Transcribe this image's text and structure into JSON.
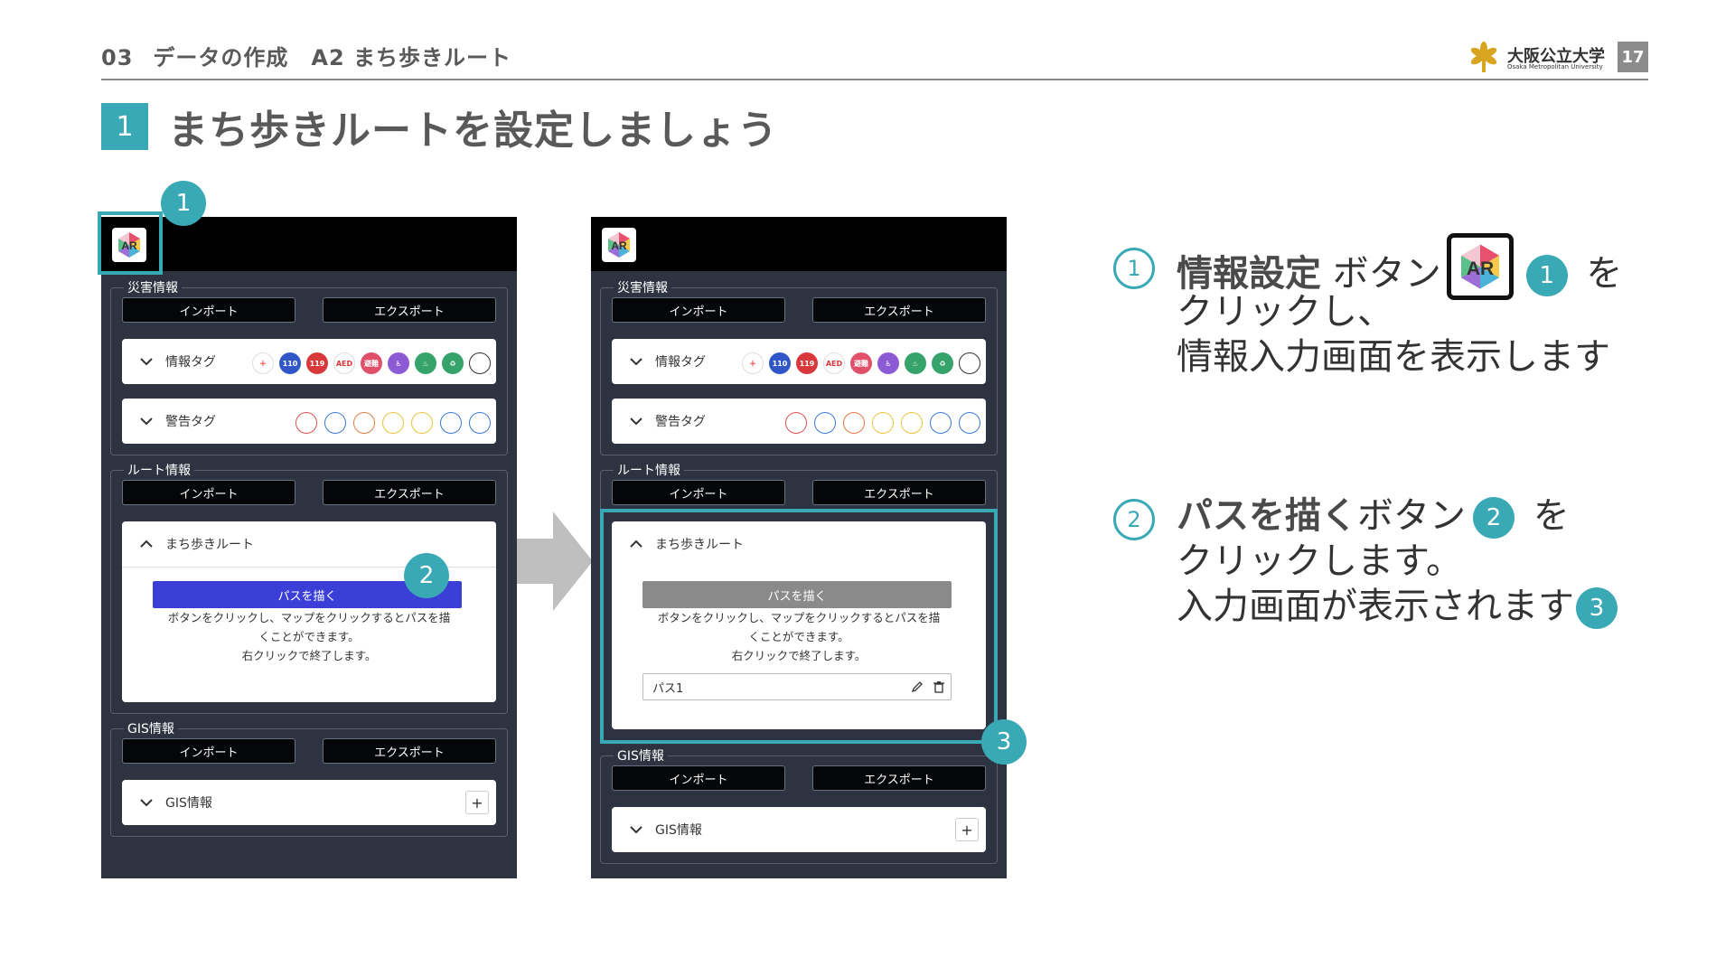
{
  "header": {
    "section_number": "03",
    "section_title": "データの作成　A2 まち歩きルート",
    "university_jp": "大阪公立大学",
    "university_en": "Osaka Metropolitan University",
    "page_number": "17"
  },
  "title": {
    "number": "1",
    "text": "まち歩きルートを設定しましょう"
  },
  "app": {
    "disaster_group": "災害情報",
    "route_group": "ルート情報",
    "gis_group": "GIS情報",
    "import_label": "インポート",
    "export_label": "エクスポート",
    "info_tag_label": "情報タグ",
    "info_tags": [
      "＋",
      "110",
      "119",
      "AED",
      "避難",
      "♿",
      "♨",
      "♻",
      ""
    ],
    "warning_tag_label": "警告タグ",
    "route_name": "まち歩きルート",
    "draw_path_label": "パスを描く",
    "help_line1": "ボタンをクリックし、マップをクリックするとパスを描",
    "help_line2": "くことができます。",
    "help_line3": "右クリックで終了します。",
    "path_item": "パス1",
    "gis_item": "GIS情報",
    "add_symbol": "+"
  },
  "callouts": {
    "one": "1",
    "two": "2",
    "three": "3"
  },
  "steps": [
    {
      "num": "1",
      "bold": "情報設定",
      "line1_rest": " ボタン",
      "badge": "1",
      "suffix": " を",
      "line2": "クリックし、",
      "line3": "情報入力画面を表示します"
    },
    {
      "num": "2",
      "bold": "パスを描く",
      "line1_rest": "ボタン",
      "badge": "2",
      "suffix": " を",
      "line2": "クリックします。",
      "line3": "入力画面が表示されます",
      "badge3": "3"
    }
  ],
  "colors": {
    "accent": "#3aa9b6",
    "draw_button_active": "#3b3fd8",
    "draw_button_disabled": "#8a8a8a",
    "panel": "#2e3341"
  }
}
